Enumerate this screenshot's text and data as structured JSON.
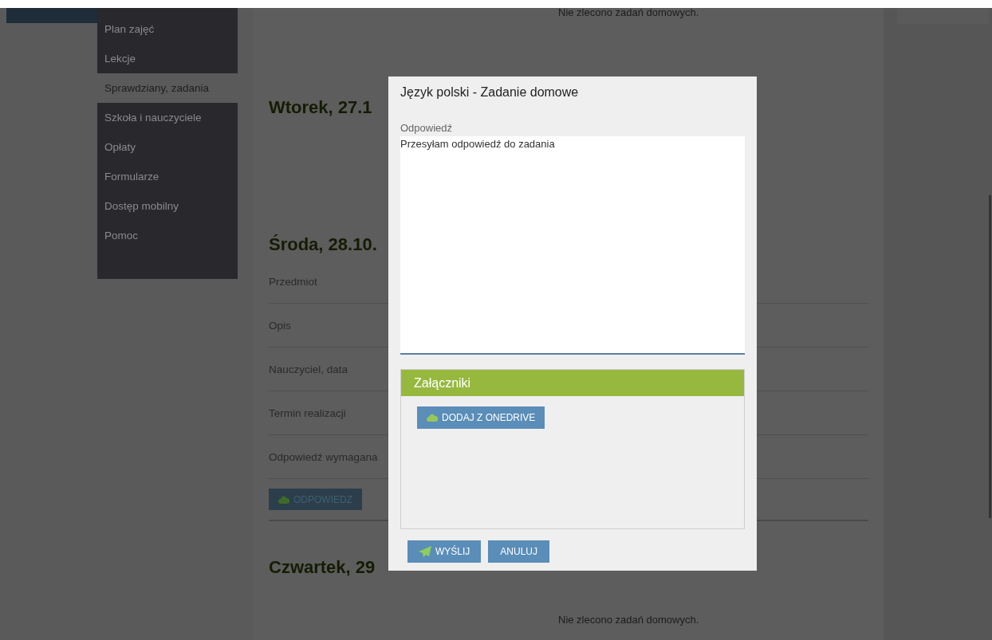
{
  "sidebar": {
    "items": [
      {
        "label": "Plan zajęć",
        "selected": false
      },
      {
        "label": "Lekcje",
        "selected": false
      },
      {
        "label": "Sprawdziany, zadania",
        "selected": true
      },
      {
        "label": "Szkoła i nauczyciele",
        "selected": false
      },
      {
        "label": "Opłaty",
        "selected": false
      },
      {
        "label": "Formularze",
        "selected": false
      },
      {
        "label": "Dostęp mobilny",
        "selected": false
      },
      {
        "label": "Pomoc",
        "selected": false
      }
    ]
  },
  "content": {
    "top_note": "Nie zlecono zadań domowych.",
    "days": [
      {
        "heading": "Wtorek, 27.1"
      },
      {
        "heading": "Środa, 28.10.",
        "fields": [
          "Przedmiot",
          "Opis",
          "Nauczyciel, data",
          "Termin realizacji",
          "Odpowiedź wymagana"
        ],
        "button": "ODPOWIEDZ"
      },
      {
        "heading": "Czwartek, 29",
        "note": "Nie zlecono zadań domowych."
      }
    ]
  },
  "dialog": {
    "title": "Język polski - Zadanie domowe",
    "answer_label": "Odpowiedź",
    "answer_value": "Przesyłam odpowiedź do zadania",
    "attachments": {
      "title": "Załączniki",
      "button": "DODAJ Z ONEDRIVE"
    },
    "buttons": [
      {
        "kind": "send",
        "label": "WYŚLIJ"
      },
      {
        "kind": "cancel",
        "label": "ANULUJ"
      }
    ]
  }
}
